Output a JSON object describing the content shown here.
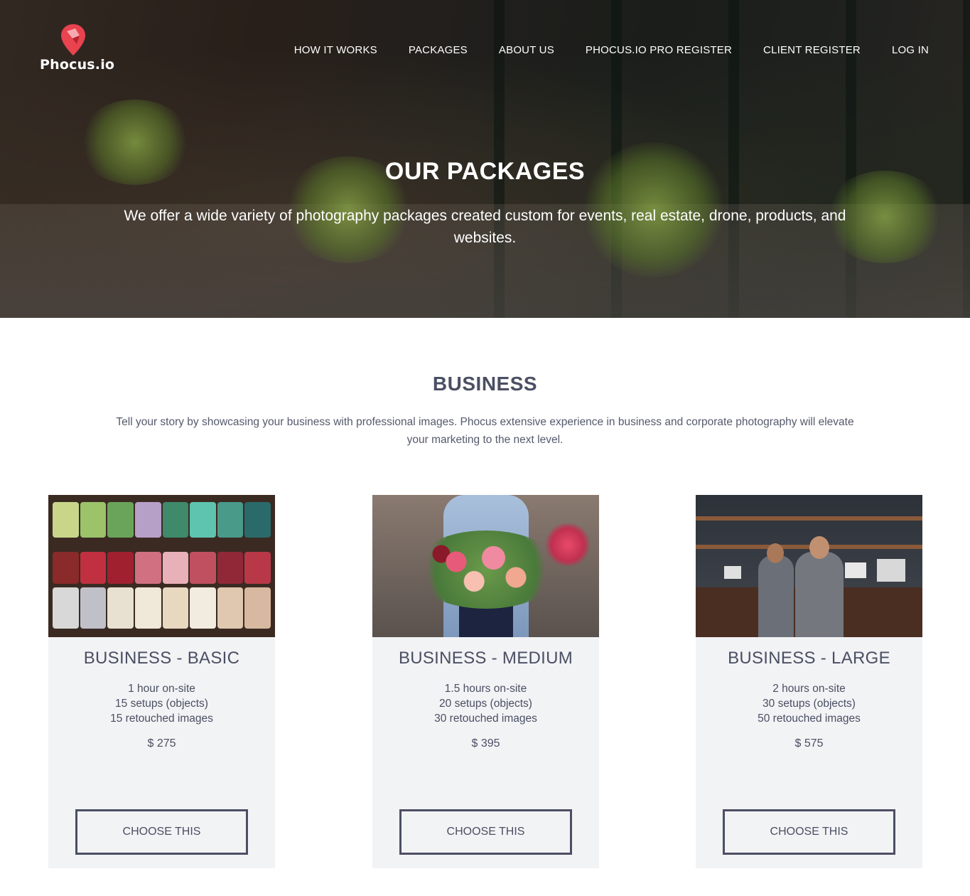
{
  "brand": {
    "name": "Phocus.io",
    "accent": "#e8434f"
  },
  "nav": {
    "items": [
      {
        "label": "HOW IT WORKS"
      },
      {
        "label": "PACKAGES"
      },
      {
        "label": "ABOUT US"
      },
      {
        "label": "PHOCUS.IO PRO REGISTER"
      },
      {
        "label": "CLIENT REGISTER"
      },
      {
        "label": "LOG IN"
      }
    ]
  },
  "hero": {
    "title": "OUR PACKAGES",
    "subtitle": "We offer a wide variety of photography packages created custom for events, real estate, drone, products, and websites."
  },
  "section": {
    "title": "BUSINESS",
    "description": "Tell your story by showcasing your business with professional images. Phocus extensive experience in business and corporate photography will elevate your marketing to the next level."
  },
  "packages": [
    {
      "name": "BUSINESS - BASIC",
      "features": [
        "1 hour on-site",
        "15 setups (objects)",
        "15 retouched images"
      ],
      "price": "$ 275",
      "button": "CHOOSE THIS"
    },
    {
      "name": "BUSINESS - MEDIUM",
      "features": [
        "1.5 hours on-site",
        "20 setups (objects)",
        "30 retouched images"
      ],
      "price": "$ 395",
      "button": "CHOOSE THIS"
    },
    {
      "name": "BUSINESS - LARGE",
      "features": [
        "2 hours on-site",
        "30 setups (objects)",
        "50 retouched images"
      ],
      "price": "$ 575",
      "button": "CHOOSE THIS"
    }
  ],
  "colors": {
    "text": "#4a4f63",
    "card_bg": "#f2f3f5"
  }
}
